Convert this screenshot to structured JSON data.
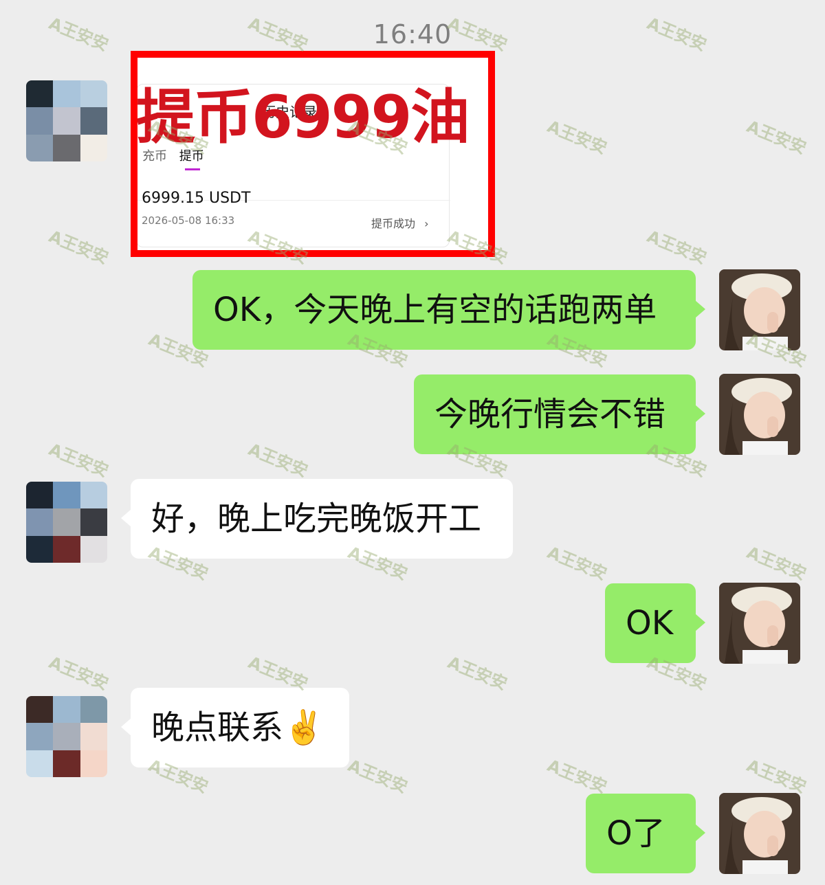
{
  "status_time": "16:40",
  "screenshot": {
    "overlay_title": "提币6999油",
    "history_label": "历史记录",
    "tabs": [
      "充币",
      "提币"
    ],
    "amount": "6999.15 USDT",
    "datetime": "2026-05-08 16:33",
    "status": "提币成功",
    "chevron": "›"
  },
  "messages": [
    {
      "sender": "me",
      "text": "OK，今天晚上有空的话跑两单"
    },
    {
      "sender": "me",
      "text": "今晚行情会不错"
    },
    {
      "sender": "other",
      "text": "好，晚上吃完晚饭开工"
    },
    {
      "sender": "me",
      "text": "OK"
    },
    {
      "sender": "other",
      "text": "晚点联系✌️"
    },
    {
      "sender": "me",
      "text": "O了"
    }
  ],
  "watermark_text": "A王安安",
  "colors": {
    "background": "#ededed",
    "my_bubble": "#95ec69",
    "their_bubble": "#ffffff",
    "highlight_frame": "#ff0000",
    "overlay_text": "#d2141e"
  },
  "icons": {
    "contact_avatar": "pixel-mosaic-avatar",
    "self_avatar": "girl-in-cap-avatar",
    "victory_emoji": "victory-hand"
  }
}
